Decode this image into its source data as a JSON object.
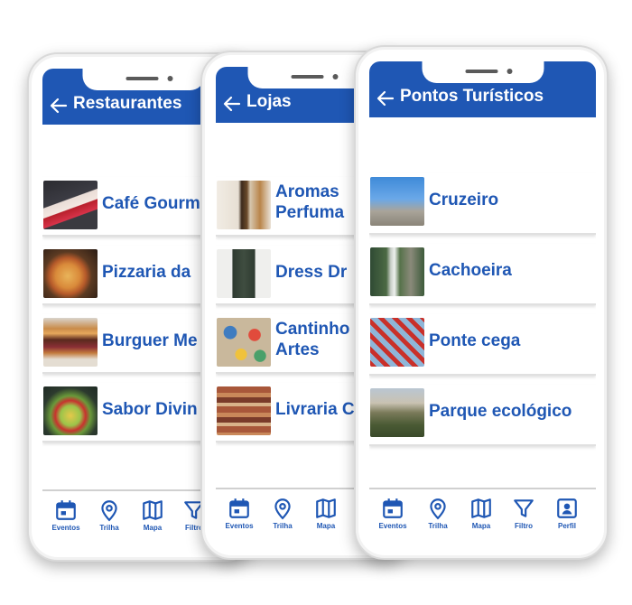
{
  "colors": {
    "brand": "#1f57b4",
    "background": "#ffffff",
    "divider": "#e0e0e0"
  },
  "tabs": {
    "eventos": "Eventos",
    "trilha": "Trilha",
    "mapa": "Mapa",
    "filtro": "Filtro",
    "perfil": "Perfil"
  },
  "screens": [
    {
      "title": "Restaurantes",
      "items": [
        {
          "name": "Café Gourm",
          "thumb": "cake-photo"
        },
        {
          "name": "Pizzaria da",
          "thumb": "pizza-photo"
        },
        {
          "name": "Burguer Me",
          "thumb": "burger-photo"
        },
        {
          "name": "Sabor Divin",
          "thumb": "salad-photo"
        }
      ]
    },
    {
      "title": "Lojas",
      "items": [
        {
          "name": "Aromas",
          "name2": "Perfuma",
          "thumb": "perfume-photo"
        },
        {
          "name": "Dress Dr",
          "thumb": "dress-photo"
        },
        {
          "name": "Cantinho",
          "name2": "Artes",
          "thumb": "paint-photo"
        },
        {
          "name": "Livraria C",
          "thumb": "books-photo"
        }
      ]
    },
    {
      "title": "Pontos Turísticos",
      "items": [
        {
          "name": "Cruzeiro",
          "thumb": "statue-photo"
        },
        {
          "name": "Cachoeira",
          "thumb": "waterfall-photo"
        },
        {
          "name": "Ponte cega",
          "thumb": "bridge-photo"
        },
        {
          "name": "Parque ecológico",
          "thumb": "park-photo"
        }
      ]
    }
  ]
}
